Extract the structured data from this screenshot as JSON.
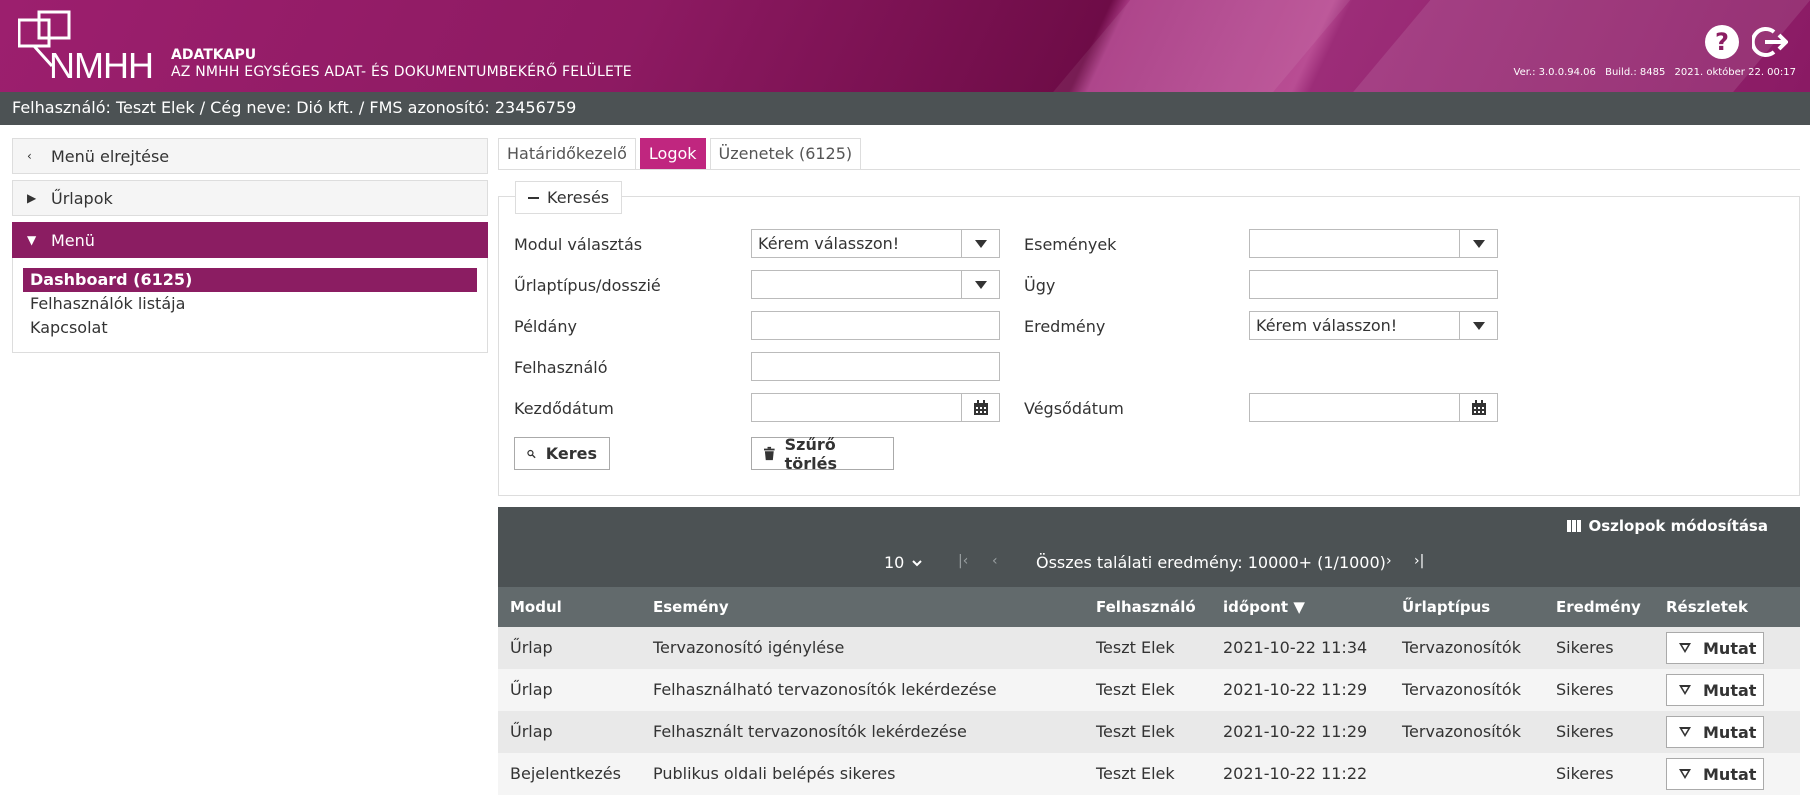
{
  "header": {
    "app_name": "ADATKAPU",
    "app_subtitle": "AZ NMHH EGYSÉGES ADAT- ÉS DOKUMENTUMBEKÉRŐ FELÜLETE",
    "logo_text": "NMHH",
    "version": "Ver.: 3.0.0.94.06",
    "build": "Build.: 8485",
    "date": "2021. október 22. 00:17",
    "help_icon": "help-icon",
    "logout_icon": "logout-icon"
  },
  "userbar": {
    "text": "Felhasználó: Teszt Elek / Cég neve: Dió kft. / FMS azonosító: 23456759"
  },
  "sidebar": {
    "hide_menu": "Menü elrejtése",
    "forms": "Űrlapok",
    "menu": "Menü",
    "links": [
      "Dashboard (6125)",
      "Felhasználók listája",
      "Kapcsolat"
    ]
  },
  "tabs": [
    "Határidőkezelő",
    "Logok",
    "Üzenetek (6125)"
  ],
  "search": {
    "legend": "Keresés",
    "fields": {
      "module_label": "Modul választás",
      "module_value": "Kérem válasszon!",
      "formtype_label": "Űrlaptípus/dosszié",
      "formtype_value": "",
      "instance_label": "Példány",
      "instance_value": "",
      "user_label": "Felhasználó",
      "user_value": "",
      "startdate_label": "Kezdődátum",
      "startdate_value": "",
      "events_label": "Események",
      "events_value": "",
      "case_label": "Ügy",
      "case_value": "",
      "result_label": "Eredmény",
      "result_value": "Kérem válasszon!",
      "enddate_label": "Végsődátum",
      "enddate_value": ""
    },
    "search_button": "Keres",
    "clear_button": "Szűrő törlés"
  },
  "grid": {
    "columns_button": "Oszlopok módosítása",
    "page_size": "10",
    "total": "Összes találati eredmény: 10000+ (1/1000)",
    "headers": [
      "Modul",
      "Esemény",
      "Felhasználó",
      "időpont",
      "Űrlaptípus",
      "Eredmény",
      "Részletek"
    ],
    "rows": [
      {
        "modul": "Űrlap",
        "esemeny": "Tervazonosító igénylése",
        "felhasznalo": "Teszt Elek",
        "idopont": "2021-10-22 11:34",
        "urlaptipus": "Tervazonosítók",
        "eredmeny": "Sikeres",
        "reszletek": "Mutat"
      },
      {
        "modul": "Űrlap",
        "esemeny": "Felhasználható tervazonosítók lekérdezése",
        "felhasznalo": "Teszt Elek",
        "idopont": "2021-10-22 11:29",
        "urlaptipus": "Tervazonosítók",
        "eredmeny": "Sikeres",
        "reszletek": "Mutat"
      },
      {
        "modul": "Űrlap",
        "esemeny": "Felhasznált tervazonosítók lekérdezése",
        "felhasznalo": "Teszt Elek",
        "idopont": "2021-10-22 11:29",
        "urlaptipus": "Tervazonosítók",
        "eredmeny": "Sikeres",
        "reszletek": "Mutat"
      },
      {
        "modul": "Bejelentkezés",
        "esemeny": "Publikus oldali belépés sikeres",
        "felhasznalo": "Teszt Elek",
        "idopont": "2021-10-22 11:22",
        "urlaptipus": "",
        "eredmeny": "Sikeres",
        "reszletek": "Mutat"
      }
    ]
  },
  "colors": {
    "brand": "#8b1d62",
    "tab_active": "#c0267f",
    "bar": "#4c5254"
  }
}
